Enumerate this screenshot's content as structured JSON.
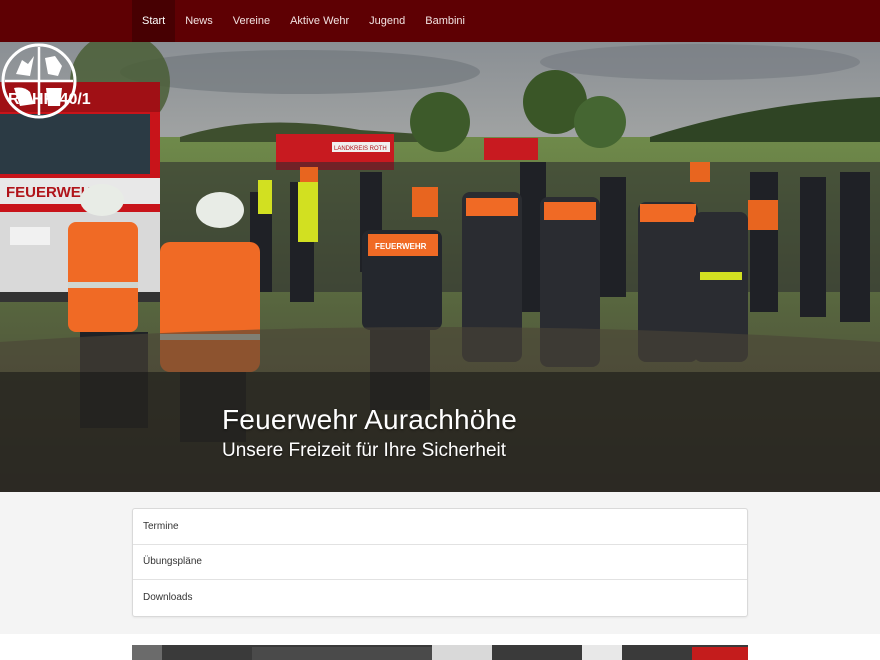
{
  "nav": {
    "items": [
      {
        "label": "Start",
        "active": true
      },
      {
        "label": "News"
      },
      {
        "label": "Vereine"
      },
      {
        "label": "Aktive Wehr"
      },
      {
        "label": "Jugend"
      },
      {
        "label": "Bambini"
      }
    ]
  },
  "hero": {
    "title": "Feuerwehr Aurachhöhe",
    "subtitle": "Unsere Freizeit für Ihre Sicherheit",
    "truck_text": "ROHR 40/1",
    "truck_band": "FEUERWEHR",
    "truck2_text": "LANDKREIS ROTH",
    "jacket_text": "FEUERWEHR"
  },
  "links": {
    "items": [
      "Termine",
      "Übungspläne",
      "Downloads"
    ]
  },
  "colors": {
    "navbar": "#5e0003",
    "nav_active": "#470002",
    "hero_band": "rgba(20,20,20,0.55)",
    "page_bg": "#f4f4f4"
  }
}
